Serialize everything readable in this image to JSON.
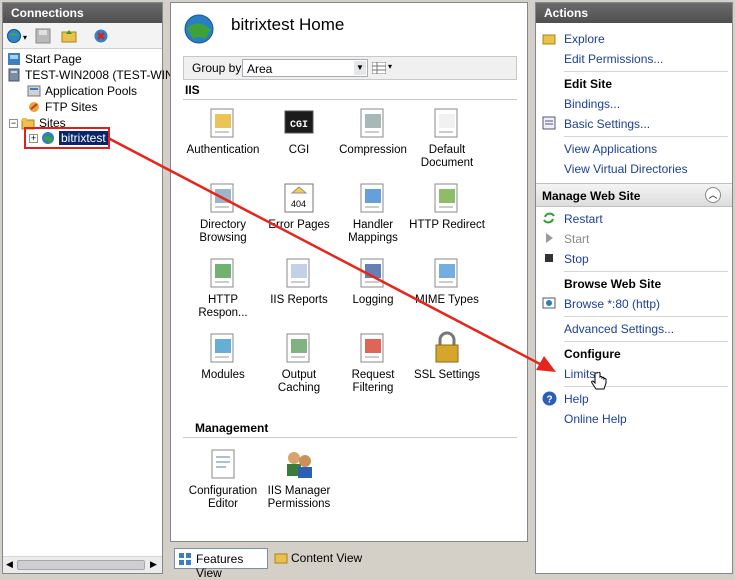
{
  "connections": {
    "title": "Connections",
    "tree": {
      "start_page": "Start Page",
      "server": "TEST-WIN2008 (TEST-WIN",
      "app_pools": "Application Pools",
      "ftp_sites": "FTP Sites",
      "sites": "Sites",
      "site": "bitrixtest"
    }
  },
  "center": {
    "title": "bitrixtest Home",
    "group_by_label": "Group by:",
    "group_by_value": "Area",
    "sections": {
      "iis": "IIS",
      "management": "Management"
    },
    "features": [
      {
        "label": "Authentication"
      },
      {
        "label": "CGI"
      },
      {
        "label": "Compression"
      },
      {
        "label": "Default Document"
      },
      {
        "label": "Directory Browsing"
      },
      {
        "label": "Error Pages"
      },
      {
        "label": "Handler Mappings"
      },
      {
        "label": "HTTP Redirect"
      },
      {
        "label": "HTTP Respon..."
      },
      {
        "label": "IIS Reports"
      },
      {
        "label": "Logging"
      },
      {
        "label": "MIME Types"
      },
      {
        "label": "Modules"
      },
      {
        "label": "Output Caching"
      },
      {
        "label": "Request Filtering"
      },
      {
        "label": "SSL Settings"
      }
    ],
    "management_features": [
      {
        "label": "Configuration Editor"
      },
      {
        "label": "IIS Manager Permissions"
      }
    ],
    "cgi_icon_text": "CGI",
    "error_icon_text": "404",
    "features_view": "Features View",
    "content_view": "Content View"
  },
  "actions": {
    "title": "Actions",
    "explore": "Explore",
    "edit_permissions": "Edit Permissions...",
    "edit_site": "Edit Site",
    "bindings": "Bindings...",
    "basic_settings": "Basic Settings...",
    "view_applications": "View Applications",
    "view_virtual_directories": "View Virtual Directories",
    "manage_web_site": "Manage Web Site",
    "restart": "Restart",
    "start": "Start",
    "stop": "Stop",
    "browse_web_site": "Browse Web Site",
    "browse_80": "Browse *:80 (http)",
    "advanced_settings": "Advanced Settings...",
    "configure": "Configure",
    "limits": "Limits...",
    "help": "Help",
    "online_help": "Online Help"
  },
  "colors": {
    "header_bg": "#5a5a5a",
    "link": "#1c3f95",
    "highlight": "#e8251c",
    "selection": "#0a246a"
  }
}
